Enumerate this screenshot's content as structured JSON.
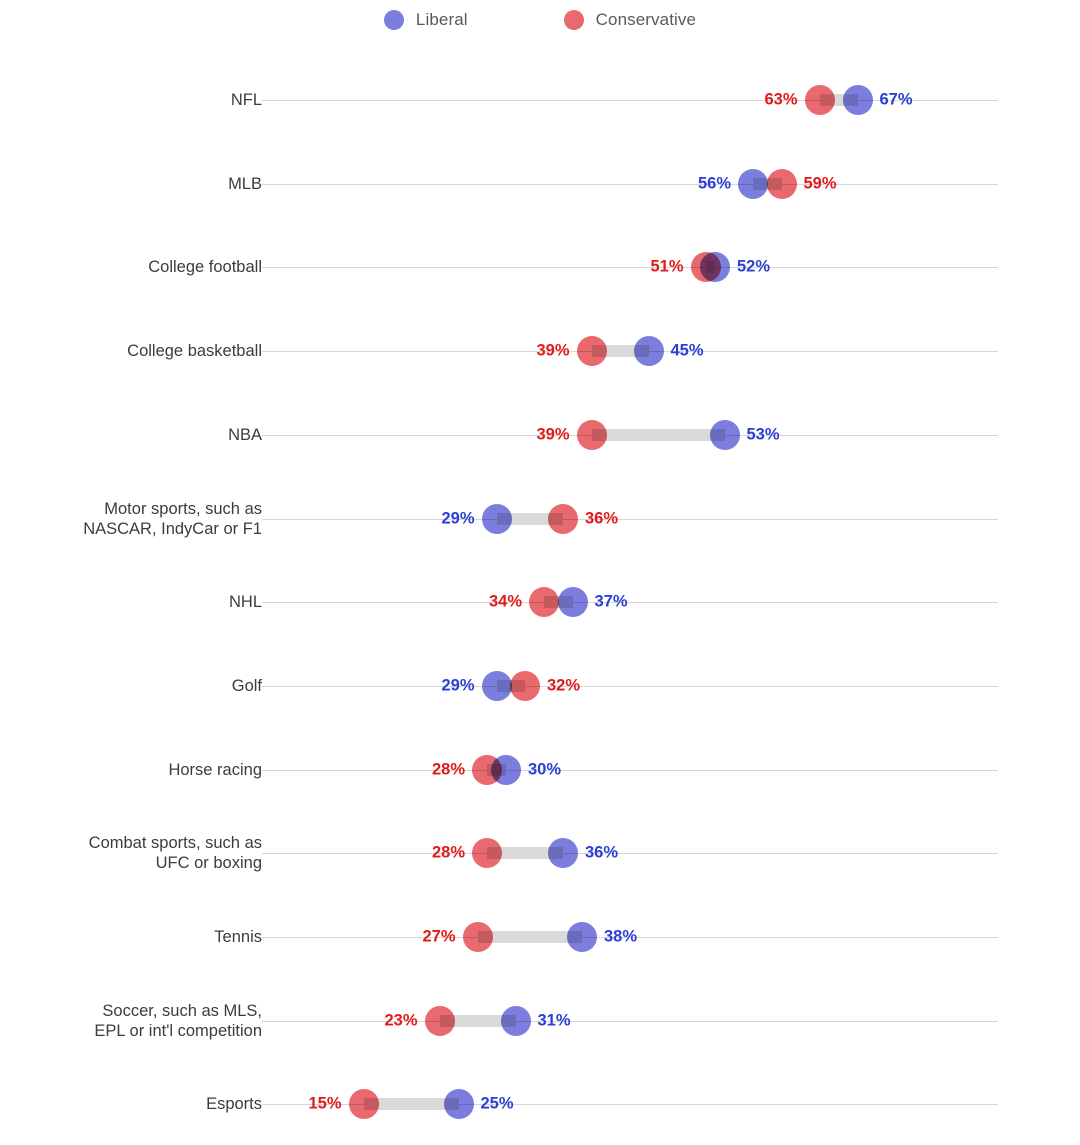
{
  "legend": {
    "items": [
      {
        "label": "Liberal",
        "color": "#7b7edc",
        "icon": "circle-icon"
      },
      {
        "label": "Conservative",
        "color": "#e8696e",
        "icon": "circle-icon"
      }
    ]
  },
  "colors": {
    "liberal_marker": "#7b7edc",
    "conservative_marker": "#e8696e",
    "liberal_label": "#2b3fd4",
    "conservative_label": "#e01b1b",
    "connector": "#d9d9d9",
    "axis": "#d6d6d6",
    "category_label": "#3c3c3c",
    "background": "#ffffff"
  },
  "chart_data": {
    "type": "scatter",
    "subtype": "dumbbell",
    "title": "",
    "subtitle": "",
    "xlabel": "",
    "ylabel": "",
    "xlim": [
      0,
      85
    ],
    "grid": false,
    "legend_position": "top-center",
    "value_suffix": "%",
    "series": [
      {
        "name": "Liberal",
        "color": "#7b7edc",
        "values": [
          67,
          56,
          52,
          45,
          53,
          29,
          37,
          29,
          30,
          36,
          38,
          31,
          25
        ]
      },
      {
        "name": "Conservative",
        "color": "#e8696e",
        "values": [
          63,
          59,
          51,
          39,
          39,
          36,
          34,
          32,
          28,
          28,
          27,
          23,
          15
        ]
      }
    ],
    "categories": [
      "NFL",
      "MLB",
      "College football",
      "College basketball",
      "NBA",
      "Motor sports, such as\nNASCAR, IndyCar or F1",
      "NHL",
      "Golf",
      "Horse racing",
      "Combat sports, such as\nUFC or boxing",
      "Tennis",
      "Soccer, such as MLS,\nEPL or int'l competition",
      "Esports"
    ],
    "rows": [
      {
        "category": "NFL",
        "liberal": 67,
        "conservative": 63,
        "liberal_text": "67%",
        "conservative_text": "63%"
      },
      {
        "category": "MLB",
        "liberal": 56,
        "conservative": 59,
        "liberal_text": "56%",
        "conservative_text": "59%"
      },
      {
        "category": "College football",
        "liberal": 52,
        "conservative": 51,
        "liberal_text": "52%",
        "conservative_text": "51%"
      },
      {
        "category": "College basketball",
        "liberal": 45,
        "conservative": 39,
        "liberal_text": "45%",
        "conservative_text": "39%"
      },
      {
        "category": "NBA",
        "liberal": 53,
        "conservative": 39,
        "liberal_text": "53%",
        "conservative_text": "39%"
      },
      {
        "category": "Motor sports, such as\nNASCAR, IndyCar or F1",
        "liberal": 29,
        "conservative": 36,
        "liberal_text": "29%",
        "conservative_text": "36%"
      },
      {
        "category": "NHL",
        "liberal": 37,
        "conservative": 34,
        "liberal_text": "37%",
        "conservative_text": "34%"
      },
      {
        "category": "Golf",
        "liberal": 29,
        "conservative": 32,
        "liberal_text": "29%",
        "conservative_text": "32%"
      },
      {
        "category": "Horse racing",
        "liberal": 30,
        "conservative": 28,
        "liberal_text": "30%",
        "conservative_text": "28%"
      },
      {
        "category": "Combat sports, such as\nUFC or boxing",
        "liberal": 36,
        "conservative": 28,
        "liberal_text": "36%",
        "conservative_text": "28%"
      },
      {
        "category": "Tennis",
        "liberal": 38,
        "conservative": 27,
        "liberal_text": "38%",
        "conservative_text": "27%"
      },
      {
        "category": "Soccer, such as MLS,\nEPL or int'l competition",
        "liberal": 31,
        "conservative": 23,
        "liberal_text": "31%",
        "conservative_text": "23%"
      },
      {
        "category": "Esports",
        "liberal": 25,
        "conservative": 15,
        "liberal_text": "25%",
        "conservative_text": "15%"
      }
    ]
  }
}
